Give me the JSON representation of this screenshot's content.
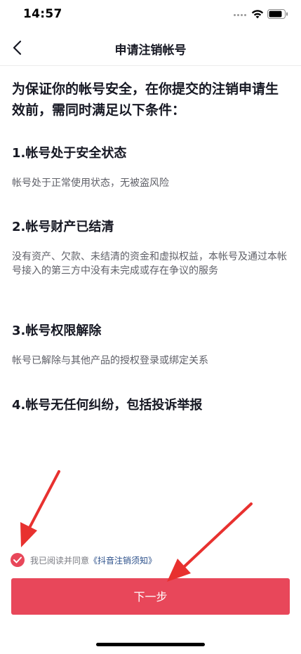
{
  "status_bar": {
    "time": "14:57",
    "wifi_icon": "wifi-icon",
    "battery_icon": "battery-icon"
  },
  "nav": {
    "back_icon": "chevron-left-icon",
    "title": "申请注销帐号"
  },
  "intro": "为保证你的帐号安全，在你提交的注销申请生效前，需同时满足以下条件：",
  "conditions": [
    {
      "title": "1.帐号处于安全状态",
      "desc": "帐号处于正常使用状态，无被盗风险"
    },
    {
      "title": "2.帐号财产已结清",
      "desc": "没有资产、欠款、未结清的资金和虚拟权益，本帐号及通过本帐号接入的第三方中没有未完成或存在争议的服务"
    },
    {
      "title": "3.帐号权限解除",
      "desc": "帐号已解除与其他产品的授权登录或绑定关系"
    },
    {
      "title": "4.帐号无任何纠纷，包括投诉举报",
      "desc": ""
    }
  ],
  "agreement": {
    "checked": true,
    "text": "我已阅读并同意",
    "link": "《抖音注销须知》"
  },
  "next_button": {
    "label": "下一步"
  },
  "colors": {
    "accent": "#e8475a",
    "link": "#2b4f8a",
    "annotation_arrow": "#e8312f"
  }
}
